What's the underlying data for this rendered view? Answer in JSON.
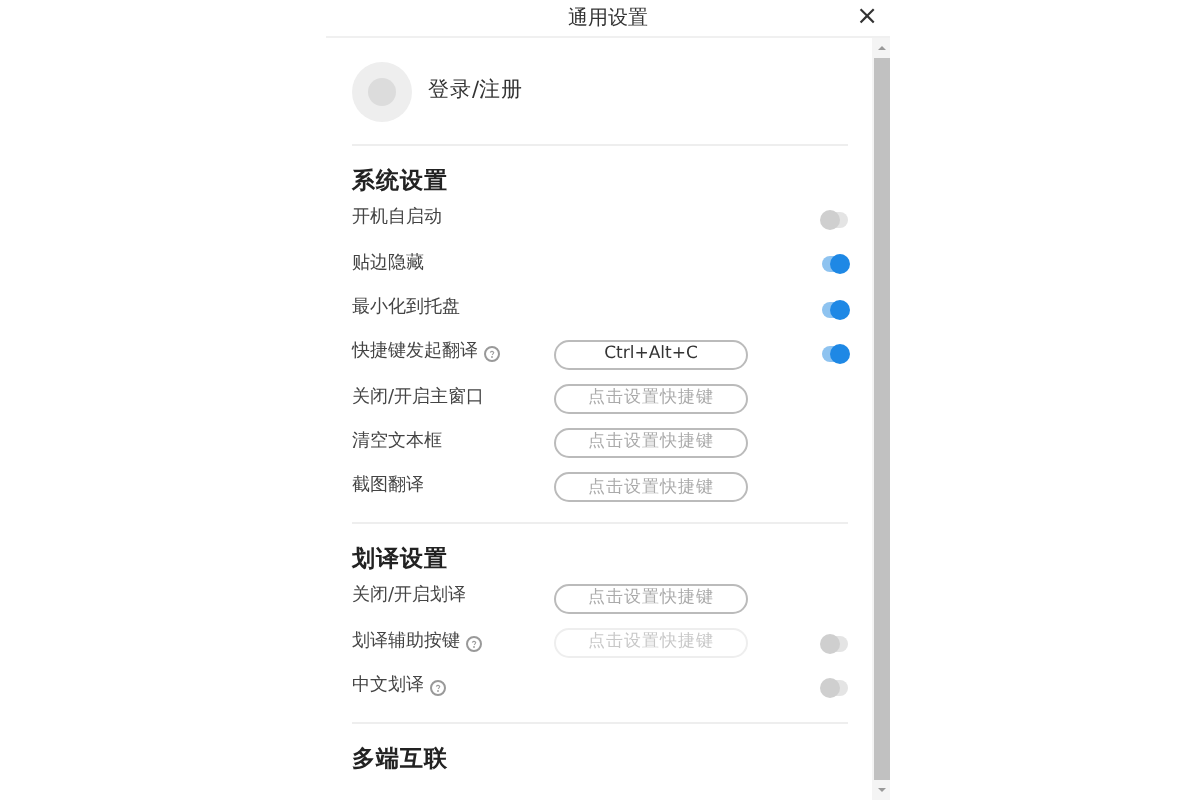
{
  "window": {
    "title": "通用设置",
    "close": "×"
  },
  "account": {
    "label": "登录/注册"
  },
  "sections": [
    {
      "title": "系统设置",
      "rows": [
        {
          "label": "开机自启动",
          "help": false,
          "toggle": {
            "on": false
          }
        },
        {
          "label": "贴边隐藏",
          "help": false,
          "toggle": {
            "on": true
          }
        },
        {
          "label": "最小化到托盘",
          "help": false,
          "toggle": {
            "on": true
          }
        },
        {
          "label": "快捷键发起翻译",
          "help": true,
          "shortcut": {
            "value": "Ctrl+Alt+C",
            "disabled": false
          },
          "toggle": {
            "on": true
          }
        },
        {
          "label": "关闭/开启主窗口",
          "help": false,
          "shortcut": {
            "placeholder": "点击设置快捷键",
            "disabled": false
          }
        },
        {
          "label": "清空文本框",
          "help": false,
          "shortcut": {
            "placeholder": "点击设置快捷键",
            "disabled": false
          }
        },
        {
          "label": "截图翻译",
          "help": false,
          "shortcut": {
            "placeholder": "点击设置快捷键",
            "disabled": false
          }
        }
      ]
    },
    {
      "title": "划译设置",
      "rows": [
        {
          "label": "关闭/开启划译",
          "help": false,
          "shortcut": {
            "placeholder": "点击设置快捷键",
            "disabled": false
          }
        },
        {
          "label": "划译辅助按键",
          "help": true,
          "shortcut": {
            "placeholder": "点击设置快捷键",
            "disabled": true
          },
          "toggle": {
            "on": false
          }
        },
        {
          "label": "中文划译",
          "help": true,
          "toggle": {
            "on": false
          }
        }
      ]
    },
    {
      "title": "多端互联"
    }
  ]
}
